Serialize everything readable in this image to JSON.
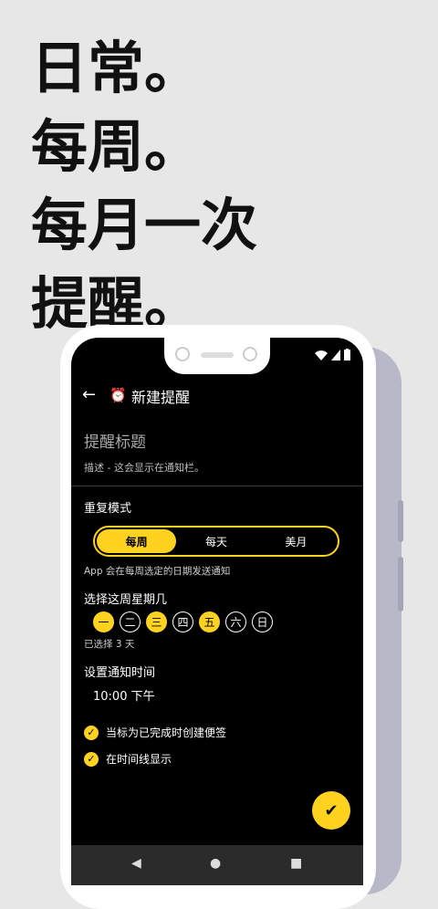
{
  "headline": [
    "日常。",
    "每周。",
    "每月一次",
    "提醒。"
  ],
  "app": {
    "title": "新建提醒",
    "back_icon": "back-arrow-icon",
    "alarm_icon": "alarm-clock-icon"
  },
  "form": {
    "title_placeholder": "提醒标题",
    "description_placeholder": "描述 - 这会显示在通知栏。"
  },
  "repeat": {
    "label": "重复模式",
    "options": [
      "每周",
      "每天",
      "美月"
    ],
    "selected": "每周",
    "hint": "App 会在每周选定的日期发送通知"
  },
  "weekdays": {
    "label": "选择这周星期几",
    "days": [
      "一",
      "二",
      "三",
      "四",
      "五",
      "六",
      "日"
    ],
    "selected": [
      "一",
      "三",
      "五"
    ],
    "summary": "已选择 3 天"
  },
  "notify_time": {
    "label": "设置通知时间",
    "value": "10:00 下午"
  },
  "checkboxes": [
    {
      "label": "当标为已完成时创建便签",
      "checked": true
    },
    {
      "label": "在时间线显示",
      "checked": true
    }
  ],
  "colors": {
    "accent": "#ffd21f",
    "background": "#e8e7e8",
    "screen": "#000000"
  }
}
